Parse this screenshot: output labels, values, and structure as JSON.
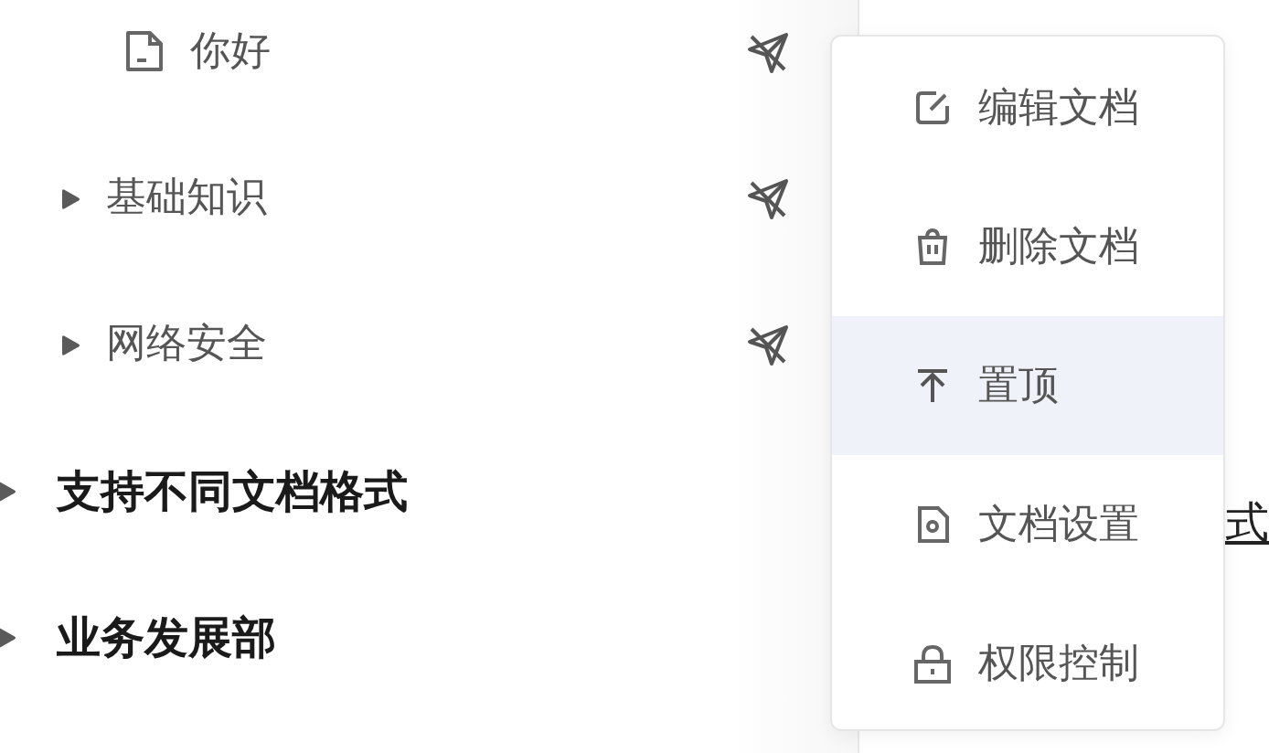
{
  "tree": [
    {
      "children": [
        {
          "children": [
            {
              "kind": "doc",
              "label": "你好"
            }
          ]
        },
        {
          "kind": "folder",
          "label": "基础知识",
          "expanded": false
        },
        {
          "kind": "folder",
          "label": "网络安全",
          "expanded": false
        }
      ]
    },
    {
      "kind": "folder",
      "label": "支持不同文档格式",
      "expanded": false
    },
    {
      "kind": "folder",
      "label": "业务发展部",
      "expanded": false
    }
  ],
  "context_menu": [
    {
      "kind": "edit",
      "label": "编辑文档",
      "selected": false
    },
    {
      "kind": "delete",
      "label": "删除文档",
      "selected": false
    },
    {
      "kind": "pin",
      "label": "置顶",
      "selected": true
    },
    {
      "kind": "settings",
      "label": "文档设置",
      "selected": false
    },
    {
      "kind": "lock",
      "label": "权限控制",
      "selected": false
    }
  ],
  "content": {
    "link": "式"
  }
}
